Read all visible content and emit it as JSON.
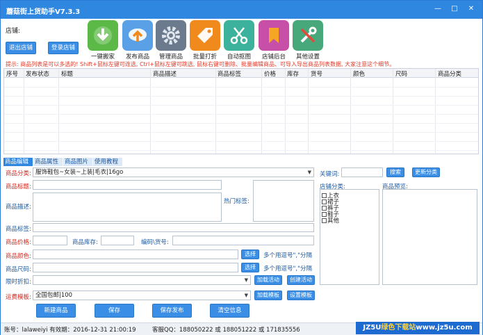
{
  "window": {
    "title": "蘑菇街上货助手V7.3.3"
  },
  "shop": {
    "label": "店铺:",
    "logout": "退出店铺",
    "login": "登录店铺"
  },
  "toolbar": [
    {
      "label": "一键搬家",
      "icon": "download-icon",
      "color": "#5cb947"
    },
    {
      "label": "发布商品",
      "icon": "upload-icon",
      "color": "#5aa0e6"
    },
    {
      "label": "管理商品",
      "icon": "gear-icon",
      "color": "#6b7a8c"
    },
    {
      "label": "批量打折",
      "icon": "tag-icon",
      "color": "#f08a1c"
    },
    {
      "label": "自动抠图",
      "icon": "scissors-icon",
      "color": "#3cb19c"
    },
    {
      "label": "店铺后台",
      "icon": "bookmark-icon",
      "color": "#c84fa7"
    },
    {
      "label": "其他设置",
      "icon": "tools-icon",
      "color": "#46a87b"
    }
  ],
  "tip": "提示: 商品列表是可以多选的! Shift+鼠标左键可连选, Ctrl+鼠标左键可跳选, 鼠标右键可删除、批量编辑商品、可导入导出商品列表数据, 大家注意这个细节。",
  "grid": {
    "columns": [
      "序号",
      "发布状态",
      "标题",
      "商品描述",
      "商品标签",
      "价格",
      "库存",
      "货号",
      "颜色",
      "尺码",
      "商品分类"
    ]
  },
  "tabs": [
    {
      "label": "商品编辑",
      "active": true
    },
    {
      "label": "商品属性",
      "active": false
    },
    {
      "label": "商品图片",
      "active": false
    },
    {
      "label": "使用教程",
      "active": false
    }
  ],
  "form": {
    "category_label": "商品分类:",
    "category_value": "服饰鞋包~女装~上装|毛衣|16go",
    "title_label": "商品标题:",
    "desc_label": "商品描述:",
    "hot_tags_label": "热门标签:",
    "tag_label": "商品标签:",
    "price_label": "商品价格:",
    "stock_label": "商品库存:",
    "code_label": "编码\\货号:",
    "color_label": "商品颜色:",
    "color_hint": "多个用逗号\",\"分隔",
    "size_label": "商品尺码:",
    "size_hint": "多个用逗号\",\"分隔",
    "discount_label": "限时折扣:",
    "shipping_label": "运费模板:",
    "shipping_value": "全国包邮|100",
    "select_btn": "选择",
    "load_activity": "加载活动",
    "create_activity": "创建活动",
    "load_template": "加载模板",
    "set_template": "设置模板"
  },
  "right": {
    "keyword_label": "关键词:",
    "search_btn": "搜索",
    "update_btn": "更新分类",
    "shop_cat_label": "店铺分类:",
    "preview_label": "商品预览:",
    "categories": [
      "上衣",
      "裙子",
      "裤子",
      "鞋子",
      "其他"
    ]
  },
  "actions": [
    "新建商品",
    "保存",
    "保存发布",
    "清空信息"
  ],
  "status": {
    "account": "账号：lalaweiyi 有效期：2016-12-31 21:00:19",
    "support": "客服QQ：188050222 或 188051222 或 171835556"
  },
  "watermark": {
    "prefix": "JZ5U",
    "middle": "绿色下载站",
    "suffix": "www.jz5u.com"
  }
}
